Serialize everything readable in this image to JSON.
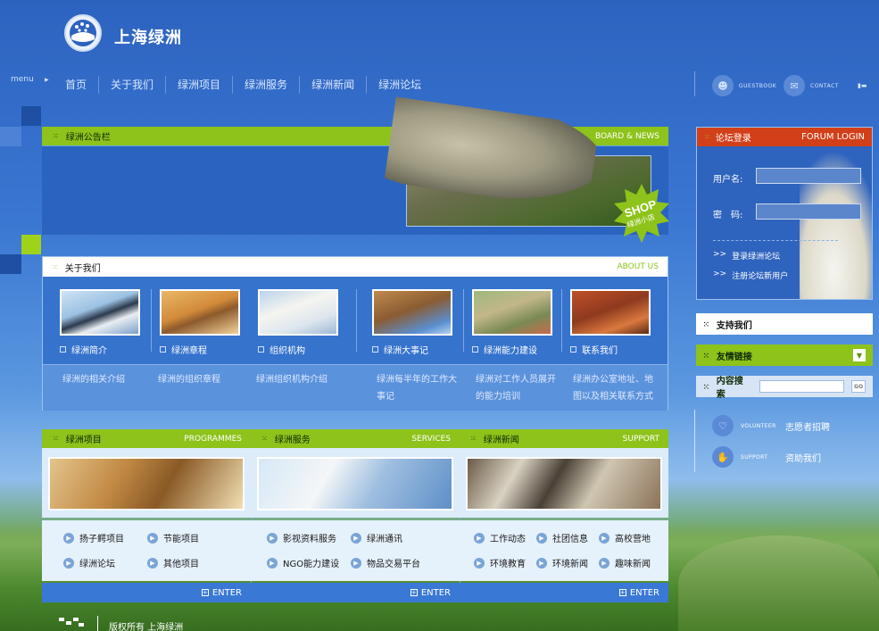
{
  "logo": {
    "title": "上海绿洲"
  },
  "nav": {
    "menu_label": "menu",
    "items": [
      "首页",
      "关于我们",
      "绿洲项目",
      "绿洲服务",
      "绿洲新闻",
      "绿洲论坛"
    ],
    "guestbook": "GUESTBOOK",
    "contact": "CONTACT"
  },
  "board": {
    "title": "绿洲公告栏",
    "en": "BOARD & NEWS",
    "shop": "SHOP",
    "shop_cn": "绿洲小店"
  },
  "about": {
    "title": "关于我们",
    "en": "ABOUT US",
    "items": [
      {
        "label": "绿洲简介",
        "desc": "绿洲的相关介绍"
      },
      {
        "label": "绿洲章程",
        "desc": "绿洲的组织章程"
      },
      {
        "label": "组织机构",
        "desc": "绿洲组织机构介绍"
      },
      {
        "label": "绿洲大事记",
        "desc": "绿洲每半年的工作大事记"
      },
      {
        "label": "绿洲能力建设",
        "desc": "绿洲对工作人员展开的能力培训"
      },
      {
        "label": "联系我们",
        "desc": "绿洲办公室地址、地图以及相关联系方式"
      }
    ]
  },
  "programmes": {
    "title": "绿洲项目",
    "en": "PROGRAMMES",
    "enter": "ENTER",
    "links": [
      "扬子鳄项目",
      "节能项目",
      "绿洲论坛",
      "其他项目"
    ]
  },
  "services": {
    "title": "绿洲服务",
    "en": "SERVICES",
    "enter": "ENTER",
    "links": [
      "影视资料服务",
      "绿洲通讯",
      "NGO能力建设",
      "物品交易平台"
    ]
  },
  "news": {
    "title": "绿洲新闻",
    "en": "SUPPORT",
    "enter": "ENTER",
    "links": [
      "工作动态",
      "社团信息",
      "高校营地",
      "环境教育",
      "环境新闻",
      "趣味新闻"
    ]
  },
  "login": {
    "title": "论坛登录",
    "en": "FORUM LOGIN",
    "username_label": "用户名:",
    "password_label": "密　码:",
    "login_link": "登录绿洲论坛",
    "register_link": "注册论坛新用户",
    "arrow": ">>"
  },
  "sidebar": {
    "support": "支持我们",
    "friends": "友情链接",
    "search": "内容搜索",
    "go": "GO",
    "volunteer_en": "VOLUNTEER",
    "volunteer": "志愿者招聘",
    "support_en": "SUPPORT",
    "donate": "资助我们"
  },
  "footer": {
    "copyright": "版权所有 上海绿洲"
  }
}
